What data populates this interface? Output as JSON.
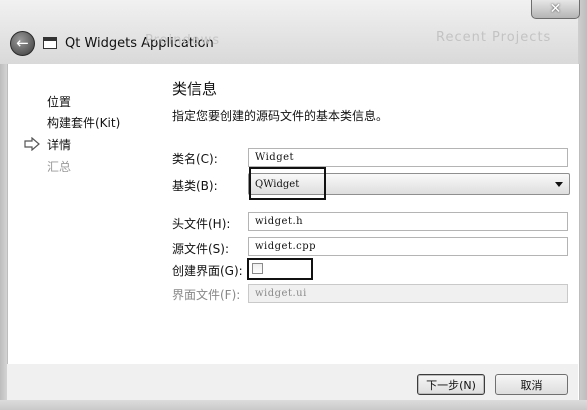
{
  "window": {
    "title": "Qt Widgets Application",
    "close_symbol": "✕",
    "back_symbol": "←",
    "ghost_left": "Proindows",
    "ghost_right": "Recent Projects"
  },
  "sidebar": {
    "items": [
      {
        "label": "位置"
      },
      {
        "label": "构建套件(Kit)"
      },
      {
        "label": "详情"
      },
      {
        "label": "汇总"
      }
    ]
  },
  "main": {
    "section_title": "类信息",
    "description": "指定您要创建的源码文件的基本类信息。",
    "fields": {
      "class_name": {
        "label": "类名(C):",
        "value": "Widget"
      },
      "base_class": {
        "label": "基类(B):",
        "value": "QWidget"
      },
      "header_file": {
        "label": "头文件(H):",
        "value": "widget.h"
      },
      "source_file": {
        "label": "源文件(S):",
        "value": "widget.cpp"
      },
      "create_form": {
        "label": "创建界面(G):",
        "checked": false
      },
      "form_file": {
        "label": "界面文件(F):",
        "value": "widget.ui"
      }
    }
  },
  "buttons": {
    "next": "下一步(N)",
    "cancel": "取消"
  }
}
